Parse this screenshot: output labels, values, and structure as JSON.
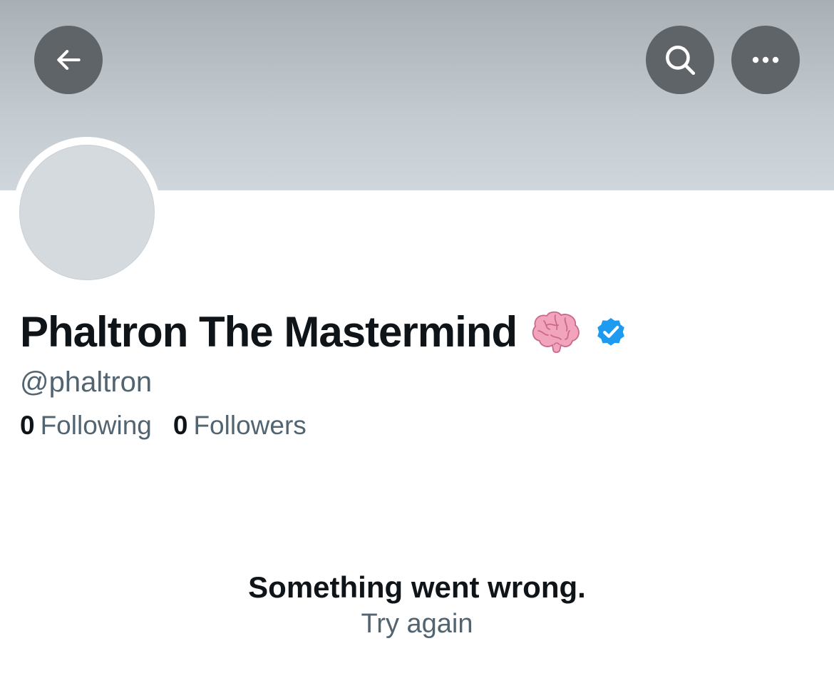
{
  "header": {
    "back_icon": "arrow-left-icon",
    "search_icon": "search-icon",
    "more_icon": "more-horizontal-icon",
    "button_color": "#5f6468",
    "banner_color": "#b8c0c6"
  },
  "profile": {
    "display_name": "Phaltron The Mastermind",
    "name_emoji_icon": "brain-icon",
    "verified_icon": "verified-badge-icon",
    "verified_color": "#1d9bf0",
    "handle": "@phaltron",
    "avatar_color": "#d5dade"
  },
  "stats": {
    "following_count": "0",
    "following_label": "Following",
    "followers_count": "0",
    "followers_label": "Followers"
  },
  "error": {
    "message": "Something went wrong.",
    "retry_label": "Try again"
  }
}
